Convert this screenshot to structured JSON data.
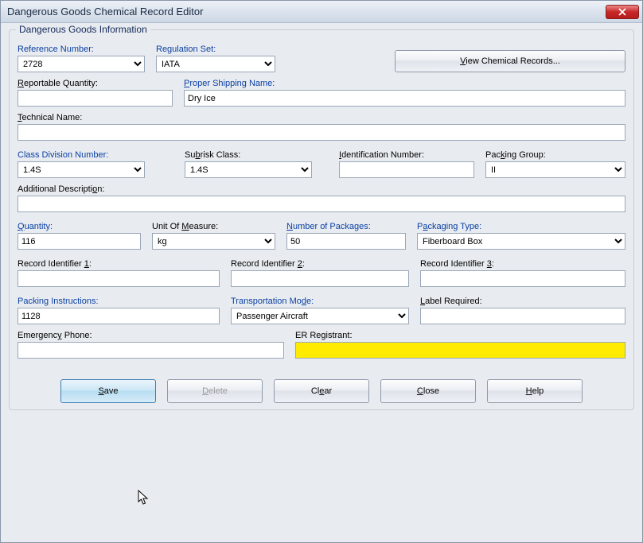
{
  "window": {
    "title": "Dangerous Goods Chemical Record Editor"
  },
  "group": {
    "legend": "Dangerous Goods Information"
  },
  "labels": {
    "reference_number": "Reference Number:",
    "regulation_set": "Regulation Set:",
    "view_chemical": "View Chemical Records...",
    "reportable_quantity": "Reportable Quantity:",
    "proper_shipping_name": "Proper Shipping Name:",
    "technical_name": "Technical Name:",
    "class_division": "Class Division Number:",
    "subrisk_class": "Subrisk Class:",
    "identification_number": "Identification Number:",
    "packing_group": "Packing Group:",
    "additional_description": "Additional Description:",
    "quantity": "Quantity:",
    "unit_of_measure": "Unit Of Measure:",
    "number_of_packages": "Number of Packages:",
    "packaging_type": "Packaging Type:",
    "record_identifier_1": "Record Identifier 1:",
    "record_identifier_2": "Record Identifier 2:",
    "record_identifier_3": "Record Identifier 3:",
    "packing_instructions": "Packing Instructions:",
    "transportation_mode": "Transportation Mode:",
    "label_required": "Label Required:",
    "emergency_phone": "Emergency Phone:",
    "er_registrant": "ER Registrant:"
  },
  "values": {
    "reference_number": "2728",
    "regulation_set": "IATA",
    "reportable_quantity": "",
    "proper_shipping_name": "Dry Ice",
    "technical_name": "",
    "class_division": "1.4S",
    "subrisk_class": "1.4S",
    "identification_number": "",
    "packing_group": "II",
    "additional_description": "",
    "quantity": "116",
    "unit_of_measure": "kg",
    "number_of_packages": "50",
    "packaging_type": "Fiberboard Box",
    "record_identifier_1": "",
    "record_identifier_2": "",
    "record_identifier_3": "",
    "packing_instructions": "1128",
    "transportation_mode": "Passenger Aircraft",
    "label_required": "",
    "emergency_phone": "",
    "er_registrant": ""
  },
  "buttons": {
    "save": "Save",
    "delete": "Delete",
    "clear": "Clear",
    "close": "Close",
    "help": "Help"
  }
}
